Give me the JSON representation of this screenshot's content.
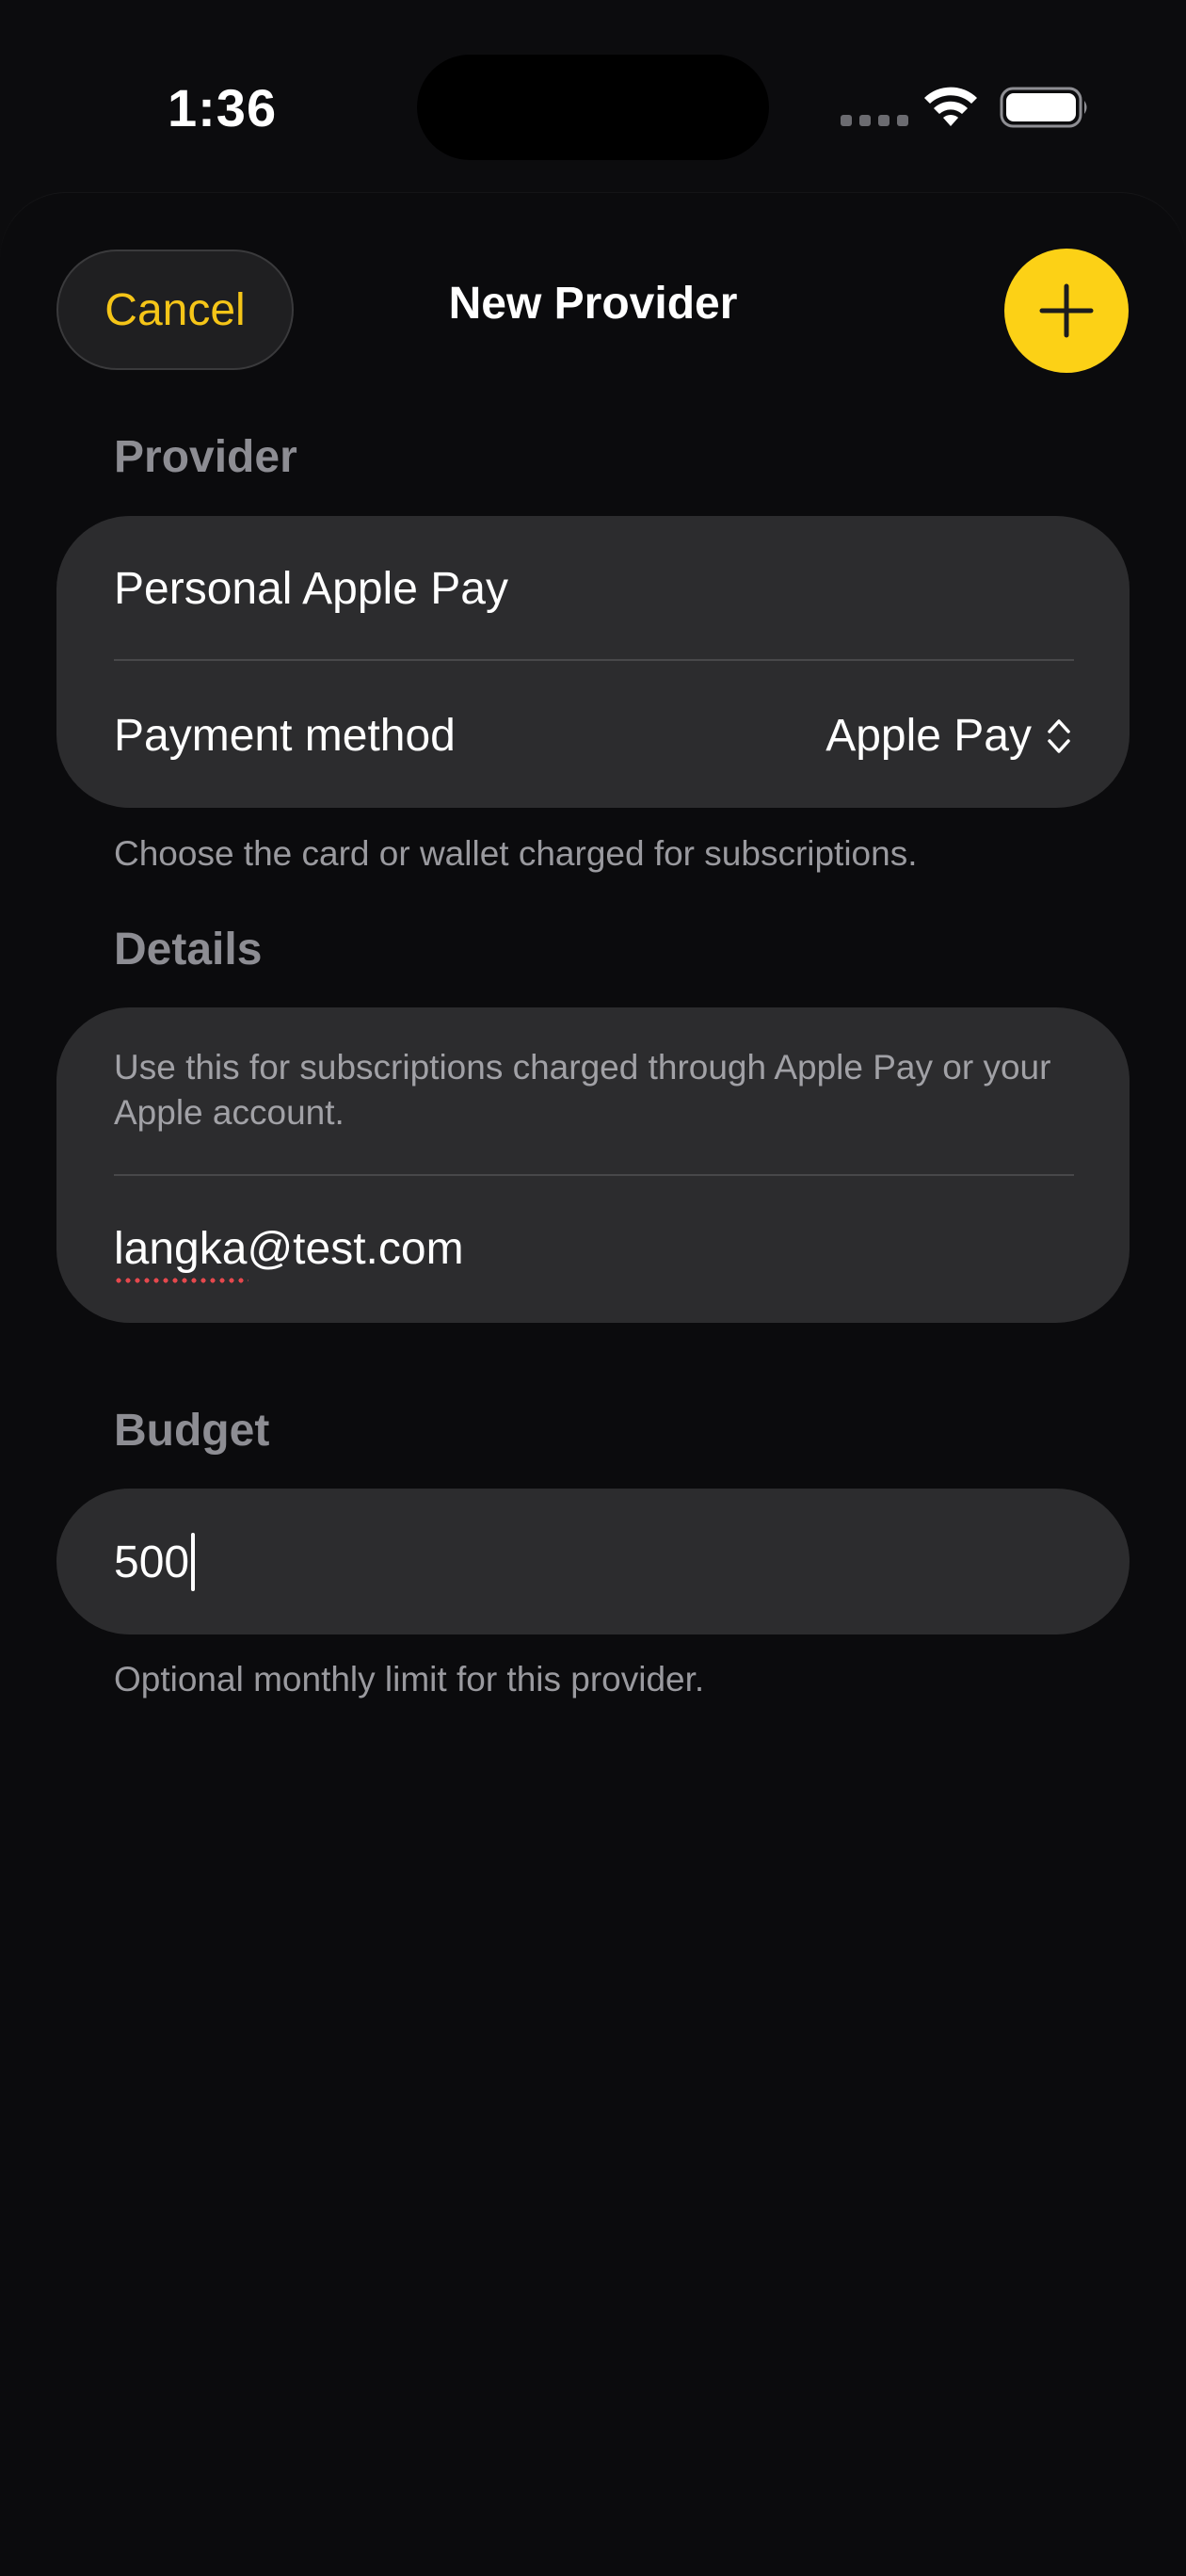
{
  "status_bar": {
    "time": "1:36"
  },
  "nav": {
    "cancel_label": "Cancel",
    "title": "New Provider",
    "add_icon": "plus-icon"
  },
  "provider_section": {
    "header": "Provider",
    "name_value": "Personal Apple Pay",
    "payment_method_label": "Payment method",
    "payment_method_value": "Apple Pay",
    "footer": "Choose the card or wallet charged for subscriptions."
  },
  "details_section": {
    "header": "Details",
    "description": "Use this for subscriptions charged through Apple Pay or your Apple account.",
    "account_value": "langka@test.com"
  },
  "budget_section": {
    "header": "Budget",
    "value": "500",
    "footer": "Optional monthly limit for this provider."
  },
  "colors": {
    "accent": "#fcd116",
    "cancel_text": "#f5c518",
    "card_background": "#2c2c2e",
    "background": "#0b0b0d"
  }
}
